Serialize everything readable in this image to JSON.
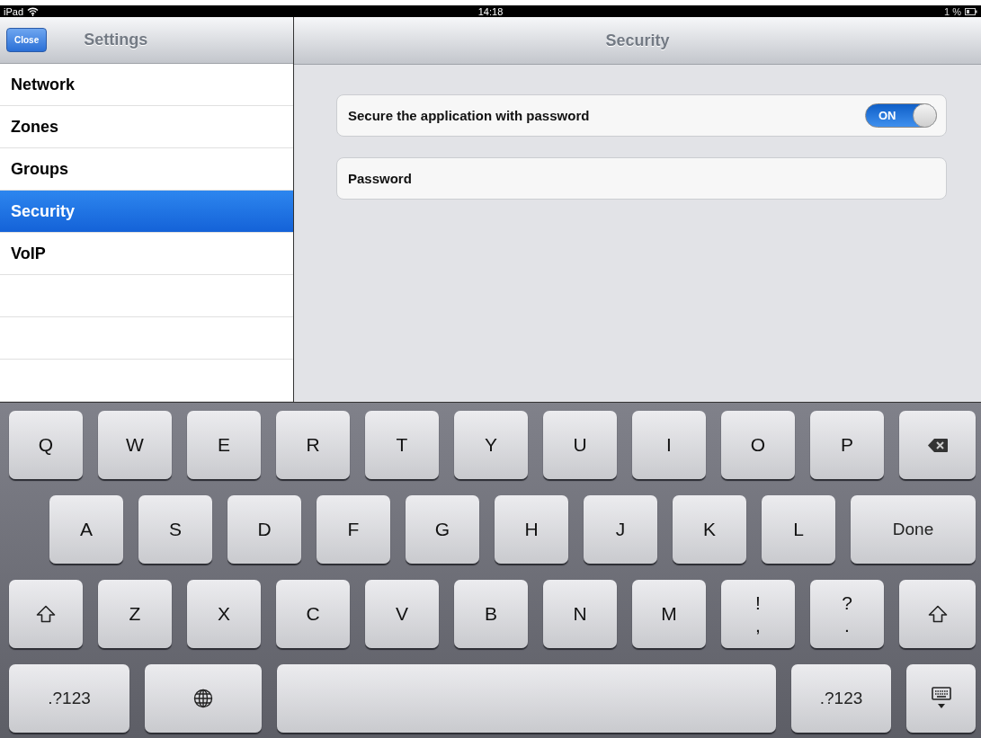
{
  "status_bar": {
    "device": "iPad",
    "time": "14:18",
    "battery": "1 %"
  },
  "sidebar": {
    "close_button": "Close",
    "title": "Settings",
    "items": [
      {
        "label": "Network",
        "selected": false
      },
      {
        "label": "Zones",
        "selected": false
      },
      {
        "label": "Groups",
        "selected": false
      },
      {
        "label": "Security",
        "selected": true
      },
      {
        "label": "VoIP",
        "selected": false
      }
    ]
  },
  "detail": {
    "title": "Security",
    "toggle": {
      "label": "Secure the application with password",
      "on": true,
      "text": "ON"
    },
    "password": {
      "label": "Password"
    }
  },
  "keyboard": {
    "rows": [
      {
        "keys": [
          {
            "kind": "char",
            "label": "Q"
          },
          {
            "kind": "char",
            "label": "W"
          },
          {
            "kind": "char",
            "label": "E"
          },
          {
            "kind": "char",
            "label": "R"
          },
          {
            "kind": "char",
            "label": "T"
          },
          {
            "kind": "char",
            "label": "Y"
          },
          {
            "kind": "char",
            "label": "U"
          },
          {
            "kind": "char",
            "label": "I"
          },
          {
            "kind": "char",
            "label": "O"
          },
          {
            "kind": "char",
            "label": "P"
          },
          {
            "kind": "backspace"
          }
        ]
      },
      {
        "keys": [
          {
            "kind": "char",
            "label": "A"
          },
          {
            "kind": "char",
            "label": "S"
          },
          {
            "kind": "char",
            "label": "D"
          },
          {
            "kind": "char",
            "label": "F"
          },
          {
            "kind": "char",
            "label": "G"
          },
          {
            "kind": "char",
            "label": "H"
          },
          {
            "kind": "char",
            "label": "J"
          },
          {
            "kind": "char",
            "label": "K"
          },
          {
            "kind": "char",
            "label": "L"
          },
          {
            "kind": "text",
            "label": "Done"
          }
        ]
      },
      {
        "keys": [
          {
            "kind": "shift"
          },
          {
            "kind": "char",
            "label": "Z"
          },
          {
            "kind": "char",
            "label": "X"
          },
          {
            "kind": "char",
            "label": "C"
          },
          {
            "kind": "char",
            "label": "V"
          },
          {
            "kind": "char",
            "label": "B"
          },
          {
            "kind": "char",
            "label": "N"
          },
          {
            "kind": "char",
            "label": "M"
          },
          {
            "kind": "dual",
            "top": "!",
            "bottom": ","
          },
          {
            "kind": "dual",
            "top": "?",
            "bottom": "."
          },
          {
            "kind": "shift"
          }
        ]
      },
      {
        "keys": [
          {
            "kind": "text",
            "label": ".?123"
          },
          {
            "kind": "globe"
          },
          {
            "kind": "space"
          },
          {
            "kind": "text",
            "label": ".?123"
          },
          {
            "kind": "hide"
          }
        ]
      }
    ]
  }
}
